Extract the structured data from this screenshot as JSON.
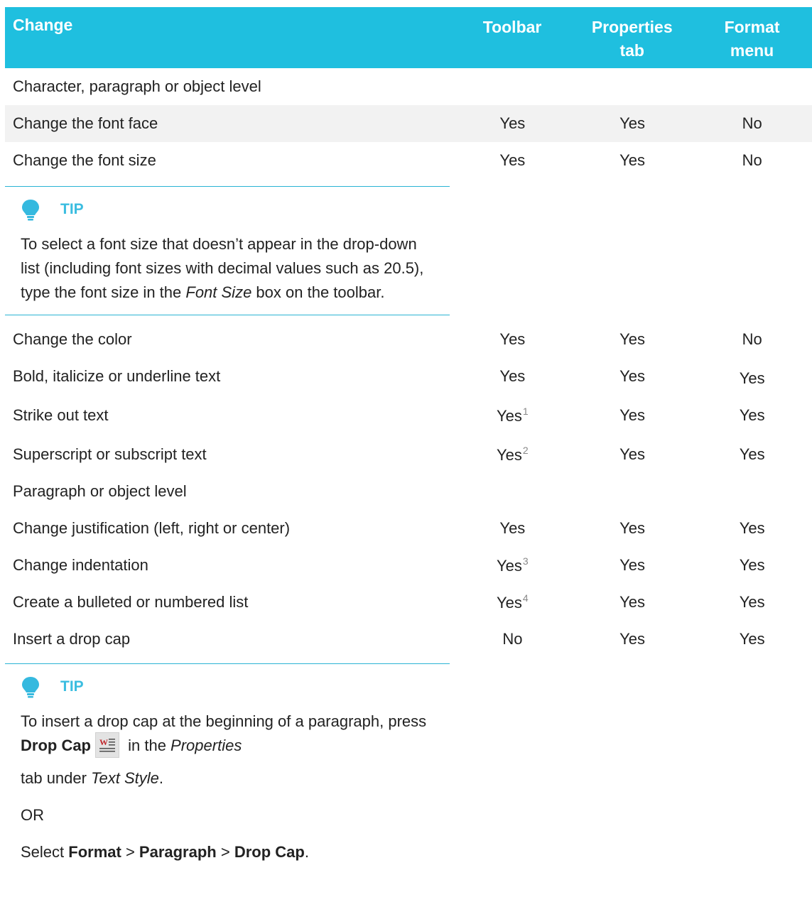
{
  "header": {
    "change": "Change",
    "toolbar": "Toolbar",
    "properties": "Properties tab",
    "format": "Format menu"
  },
  "rows": [
    {
      "label": "Character, paragraph or object level",
      "toolbar": "",
      "properties": "",
      "format": ""
    },
    {
      "label": "Change the font face",
      "toolbar": "Yes",
      "properties": "Yes",
      "format": "No"
    },
    {
      "label": "Change the font size",
      "toolbar": "Yes",
      "properties": "Yes",
      "format": "No"
    },
    {
      "label": "Change the color",
      "toolbar": "Yes",
      "properties": "Yes",
      "format": "No"
    },
    {
      "label": "Bold, italicize or underline text",
      "toolbar": "Yes",
      "properties": "Yes",
      "format": "Yes"
    },
    {
      "label": "Strike out text",
      "toolbar": "Yes",
      "toolbar_fn": "1",
      "properties": "Yes",
      "format": "Yes"
    },
    {
      "label": "Superscript or subscript text",
      "toolbar": "Yes",
      "toolbar_fn": "2",
      "properties": "Yes",
      "format": "Yes"
    },
    {
      "label": "Paragraph or object level",
      "toolbar": "",
      "properties": "",
      "format": ""
    },
    {
      "label": "Change justification (left, right or center)",
      "toolbar": "Yes",
      "properties": "Yes",
      "format": "Yes"
    },
    {
      "label": "Change indentation",
      "toolbar": "Yes",
      "toolbar_fn": "3",
      "properties": "Yes",
      "format": "Yes"
    },
    {
      "label": "Create a bulleted or numbered list",
      "toolbar": "Yes",
      "toolbar_fn": "4",
      "properties": "Yes",
      "format": "Yes"
    },
    {
      "label": "Insert a drop cap",
      "toolbar": "No",
      "properties": "Yes",
      "format": "Yes"
    }
  ],
  "tip1": {
    "label": "TIP",
    "text_a": "To select a font size that doesn’t appear in the drop-down list (including font sizes with decimal values such as 20.5), type the font size in the ",
    "italic_a": "Font Size",
    "text_b": " box on the toolbar."
  },
  "tip2": {
    "label": "TIP",
    "line1_a": "To insert a drop cap at the beginning of a paragraph, press ",
    "line1_bold": "Drop Cap",
    "line1_b": " in the ",
    "line1_italic": "Properties",
    "line2_a": "tab under ",
    "line2_italic": "Text Style",
    "line2_b": ".",
    "or": "OR",
    "select": "Select ",
    "path1": "Format",
    "sep1": " > ",
    "path2": "Paragraph",
    "sep2": " > ",
    "path3": "Drop Cap",
    "end": "."
  },
  "icons": {
    "tip": "lightbulb-icon",
    "dropcap": "drop-cap-icon"
  },
  "colors": {
    "header_bg": "#1fbfdf",
    "tip_accent": "#3bbde0",
    "shaded_row": "#f2f2f2"
  }
}
